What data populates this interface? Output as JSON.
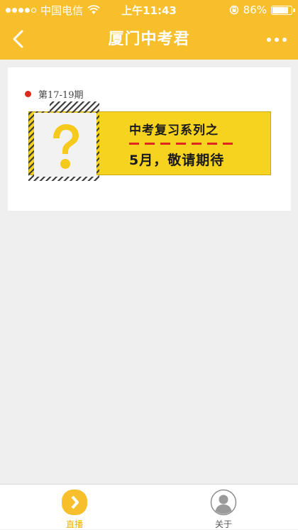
{
  "status_bar": {
    "carrier": "中国电信",
    "time": "上午11:43",
    "battery": "86%",
    "battery_level": 0.86
  },
  "nav": {
    "title": "厦门中考君",
    "back_icon": "chevron-left-icon",
    "more_icon": "more-dots-icon"
  },
  "card": {
    "issue_label": "第17-19期",
    "banner": {
      "line1": "中考复习系列之",
      "line2": "5月，敬请期待",
      "icon": "question-mark-icon"
    }
  },
  "tabs": [
    {
      "label": "直播",
      "icon": "play-icon",
      "active": true
    },
    {
      "label": "关于",
      "icon": "user-avatar-icon",
      "active": false
    }
  ],
  "colors": {
    "brand": "#f7bf2c",
    "banner_yellow": "#f6d31f",
    "accent_red": "#e0261c",
    "active_tab": "#f2b100"
  }
}
